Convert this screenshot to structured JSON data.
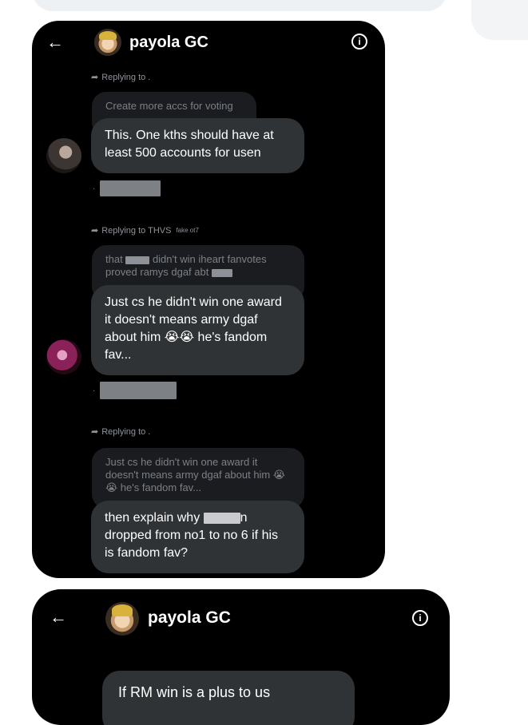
{
  "header": {
    "title": "payola GC",
    "back_icon": "arrow-left-icon",
    "info_icon": "info-icon"
  },
  "conversation": [
    {
      "replying_to": "Replying to .",
      "quoted_text": "Create more accs for voting",
      "message": "This. One kths should have at least 500 accounts for usen",
      "meta_prefix": "· "
    },
    {
      "replying_to": "Replying to THVS",
      "replying_to_suffix": "fake ot7",
      "quoted_parts": [
        "that",
        "didn't win iheart  fanvotes proved ramys dgaf abt",
        ""
      ],
      "message": "Just cs he didn't win one award it doesn't means army dgaf about him 😭😭 he's fandom fav...",
      "meta_prefix": "· "
    },
    {
      "replying_to": "Replying to .",
      "quoted_text": "Just cs he didn't win one award it doesn't means army dgaf about him 😭😭 he's fandom fav...",
      "message_parts": [
        "then explain why",
        "n dropped from no1 to no 6 if his is fandom fav?"
      ]
    }
  ],
  "second_screenshot": {
    "title": "payola GC",
    "message": "If RM win is a plus to us"
  }
}
